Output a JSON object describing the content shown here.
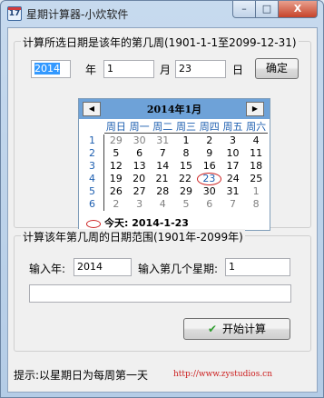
{
  "window": {
    "title": "星期计算器-小炊软件",
    "icon_text": "17"
  },
  "window_controls": {
    "minimize": "–",
    "maximize": "□",
    "close": "X"
  },
  "group1": {
    "legend": "计算所选日期是该年的第几周(1901-1-1至2099-12-31)",
    "year_value": "2014",
    "year_label": "年",
    "month_value": "1",
    "month_label": "月",
    "day_value": "23",
    "day_label": "日",
    "confirm_label": "确定"
  },
  "calendar": {
    "prev_label": "◀",
    "next_label": "▶",
    "title": "2014年1月",
    "weekdays": [
      "周日",
      "周一",
      "周二",
      "周三",
      "周四",
      "周五",
      "周六"
    ],
    "week_numbers": [
      "1",
      "2",
      "3",
      "4",
      "5",
      "6"
    ],
    "rows": [
      [
        "29",
        "30",
        "31",
        "1",
        "2",
        "3",
        "4"
      ],
      [
        "5",
        "6",
        "7",
        "8",
        "9",
        "10",
        "11"
      ],
      [
        "12",
        "13",
        "14",
        "15",
        "16",
        "17",
        "18"
      ],
      [
        "19",
        "20",
        "21",
        "22",
        "23",
        "24",
        "25"
      ],
      [
        "26",
        "27",
        "28",
        "29",
        "30",
        "31",
        "1"
      ],
      [
        "2",
        "3",
        "4",
        "5",
        "6",
        "7",
        "8"
      ]
    ],
    "today_label": "今天: 2014-1-23"
  },
  "group2": {
    "legend": "计算该年第几周的日期范围(1901年-2099年)",
    "year_label": "输入年:",
    "year_value": "2014",
    "week_label": "输入第几个星期:",
    "week_value": "1",
    "result_value": "",
    "start_label": "开始计算"
  },
  "status": {
    "hint": "提示:以星期日为每周第一天",
    "url": "http://www.zystudios.cn"
  },
  "colors": {
    "calendar_header": "#6ea2d8",
    "today_circle": "#cc2222",
    "url": "#cc2020"
  }
}
